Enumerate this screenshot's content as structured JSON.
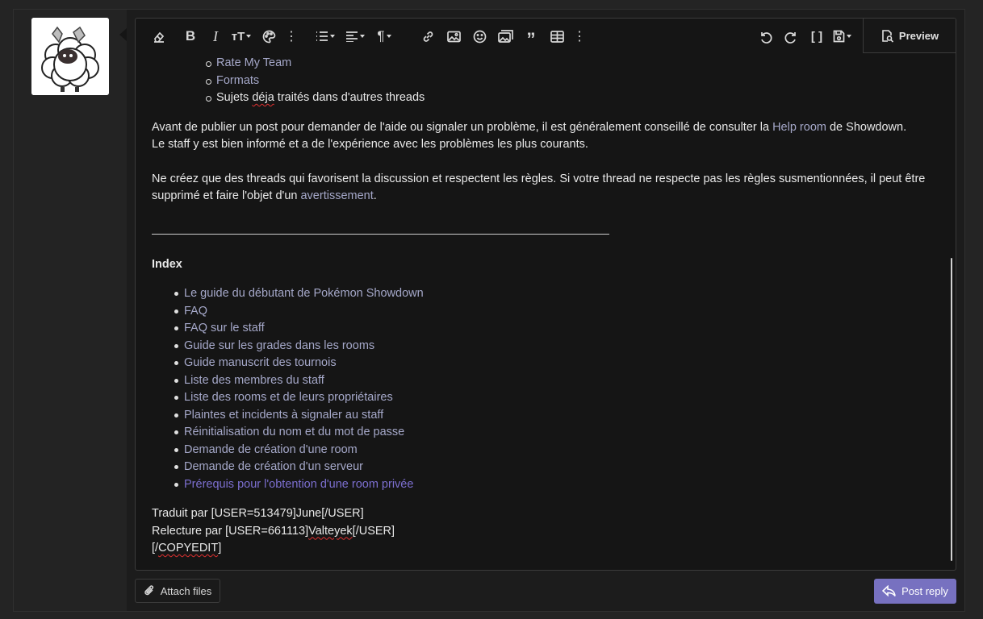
{
  "editor": {
    "preview_label": "Preview",
    "partial_top_line": "____________",
    "sub_items": [
      {
        "text": "Rate My Team",
        "link": true
      },
      {
        "text": "Formats",
        "link": true
      },
      {
        "text_a": "Sujets ",
        "text_b": "déja",
        "text_c": " traités dans d'autres threads",
        "link": false
      }
    ],
    "para1_a": "Avant de publier un post pour demander de l'aide ou signaler un problème, il est généralement conseillé de consulter la ",
    "para1_link": "Help room",
    "para1_b": " de Showdown.",
    "para1_c": "Le staff y est bien informé et a de l'expérience avec les problèmes les plus courants.",
    "para2_a": "Ne créez que des threads qui favorisent la discussion et respectent les règles. Si votre thread ne respecte pas les règles susmentionnées, il peut être supprimé et faire l'objet d'un ",
    "para2_link": "avertissement",
    "para2_b": ".",
    "index_title": "Index",
    "index_items": [
      "Le guide du débutant de Pokémon Showdown",
      "FAQ",
      "FAQ sur le staff",
      "Guide sur les grades dans les rooms",
      "Guide manuscrit des tournois",
      "Liste des membres du staff",
      "Liste des rooms et de leurs propriétaires",
      "Plaintes et incidents à signaler au staff",
      "Réinitialisation du nom et du mot de passe",
      "Demande de création d'une room",
      "Demande de création d'un serveur",
      "Prérequis pour l'obtention d'une room privée"
    ],
    "credit1": "Traduit par [USER=513479]June[/USER]",
    "credit2_a": "Relecture par [USER=661113]",
    "credit2_b": "Valteyek",
    "credit2_c": "[/USER]",
    "credit3_a": "[/",
    "credit3_b": "COPYEDIT",
    "credit3_c": "]"
  },
  "footer": {
    "attach_label": "Attach files",
    "post_label": "Post reply"
  },
  "colors": {
    "accent": "#7771c0",
    "link": "#a5a8c9",
    "visited_link": "#7c6fd0"
  }
}
